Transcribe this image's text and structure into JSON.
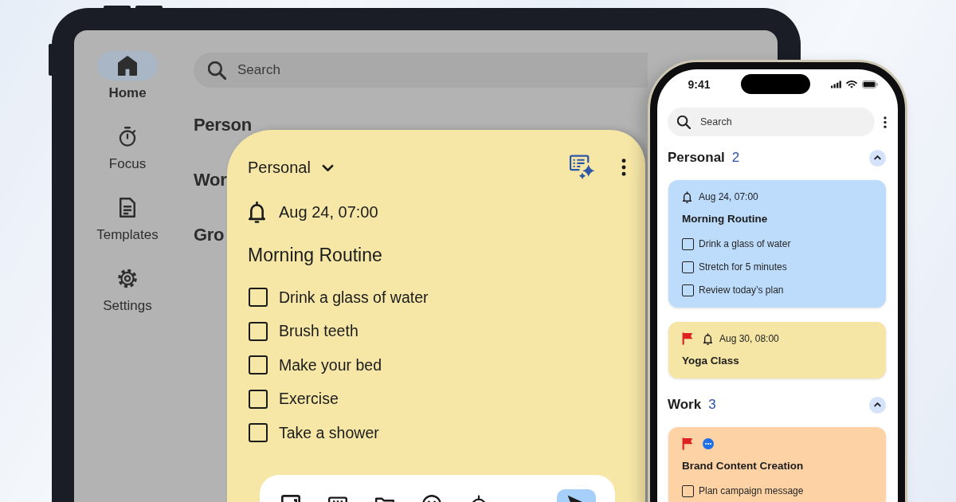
{
  "tablet": {
    "nav": [
      {
        "label": "Home",
        "selected": true
      },
      {
        "label": "Focus",
        "selected": false
      },
      {
        "label": "Templates",
        "selected": false
      },
      {
        "label": "Settings",
        "selected": false
      }
    ],
    "search": {
      "placeholder": "Search"
    },
    "group_headings": [
      "Person",
      "Wor",
      "Gro"
    ]
  },
  "note_editor": {
    "category": "Personal",
    "reminder": "Aug 24, 07:00",
    "title": "Morning Routine",
    "items": [
      {
        "text": "Drink a glass of water",
        "checked": false
      },
      {
        "text": "Brush teeth",
        "checked": false
      },
      {
        "text": "Make your bed",
        "checked": false
      },
      {
        "text": "Exercise",
        "checked": false
      },
      {
        "text": "Take a shower",
        "checked": false
      }
    ]
  },
  "phone": {
    "status_bar": {
      "time": "9:41"
    },
    "search": {
      "placeholder": "Search"
    },
    "sections": [
      {
        "name": "Personal",
        "count": "2",
        "expanded": true,
        "notes": [
          {
            "color": "#bddcfb",
            "flagged": false,
            "in_progress": false,
            "reminder": "Aug 24, 07:00",
            "title": "Morning Routine",
            "items": [
              {
                "text": "Drink a glass of water",
                "checked": false
              },
              {
                "text": "Stretch for 5 minutes",
                "checked": false
              },
              {
                "text": "Review today’s plan",
                "checked": false
              }
            ]
          },
          {
            "color": "#f5e6a6",
            "flagged": true,
            "in_progress": false,
            "reminder": "Aug 30, 08:00",
            "title": "Yoga Class"
          }
        ]
      },
      {
        "name": "Work",
        "count": "3",
        "expanded": true,
        "notes": [
          {
            "color": "#fdd3a6",
            "flagged": true,
            "in_progress": true,
            "title": "Brand Content Creation",
            "items": [
              {
                "text": "Plan campaign message",
                "checked": false
              }
            ]
          }
        ]
      }
    ]
  }
}
